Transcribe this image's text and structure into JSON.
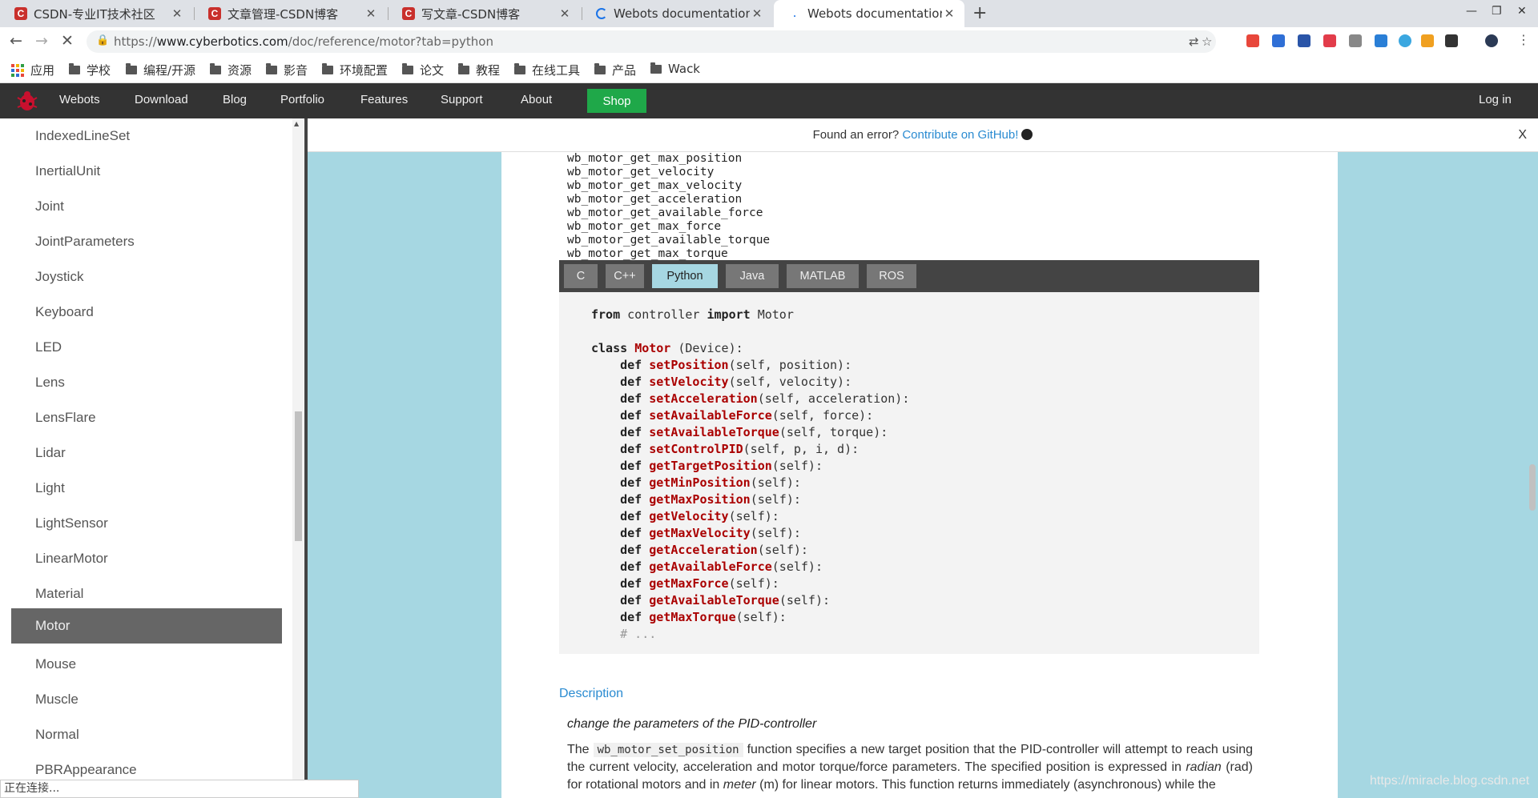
{
  "browser": {
    "tabs": [
      {
        "title": "CSDN-专业IT技术社区",
        "favicon": "csdn-icon"
      },
      {
        "title": "文章管理-CSDN博客",
        "favicon": "csdn-icon"
      },
      {
        "title": "写文章-CSDN博客",
        "favicon": "csdn-icon"
      },
      {
        "title": "Webots documentation: \\",
        "favicon": "loading-icon"
      },
      {
        "title": "Webots documentation: M",
        "favicon": "loading-icon",
        "active": true
      }
    ],
    "url_prefix": "https://",
    "url_host": "www.cyberbotics.com",
    "url_path": "/doc/reference/motor?tab=python",
    "bookmarks": [
      "应用",
      "学校",
      "编程/开源",
      "资源",
      "影音",
      "环境配置",
      "论文",
      "教程",
      "在线工具",
      "产品",
      "Wack"
    ],
    "status_text": "正在连接..."
  },
  "site": {
    "nav": [
      "Webots",
      "Download",
      "Blog",
      "Portfolio",
      "Features",
      "Support",
      "About"
    ],
    "shop_label": "Shop",
    "login_label": "Log in"
  },
  "sidebar": {
    "items": [
      "IndexedLineSet",
      "InertialUnit",
      "Joint",
      "JointParameters",
      "Joystick",
      "Keyboard",
      "LED",
      "Lens",
      "LensFlare",
      "Lidar",
      "Light",
      "LightSensor",
      "LinearMotor",
      "Material",
      "Motor",
      "Mouse",
      "Muscle",
      "Normal",
      "PBRAppearance"
    ],
    "active": "Motor"
  },
  "errbar": {
    "text": "Found an error? ",
    "link": "Contribute on GitHub!",
    "close": "X"
  },
  "article": {
    "functions": [
      "wb_motor_get_max_position",
      "wb_motor_get_velocity",
      "wb_motor_get_max_velocity",
      "wb_motor_get_acceleration",
      "wb_motor_get_available_force",
      "wb_motor_get_max_force",
      "wb_motor_get_available_torque",
      "wb_motor_get_max_torque"
    ],
    "lang_tabs": [
      "C",
      "C++",
      "Python",
      "Java",
      "MATLAB",
      "ROS"
    ],
    "active_lang": "Python",
    "code": {
      "import_from": "from",
      "import_module": " controller ",
      "import_kw": "import",
      "import_name": " Motor",
      "class_kw": "class",
      "class_name": "Motor",
      "class_base": " (Device):",
      "methods": [
        {
          "name": "setPosition",
          "args": "(self, position):"
        },
        {
          "name": "setVelocity",
          "args": "(self, velocity):"
        },
        {
          "name": "setAcceleration",
          "args": "(self, acceleration):"
        },
        {
          "name": "setAvailableForce",
          "args": "(self, force):"
        },
        {
          "name": "setAvailableTorque",
          "args": "(self, torque):"
        },
        {
          "name": "setControlPID",
          "args": "(self, p, i, d):"
        },
        {
          "name": "getTargetPosition",
          "args": "(self):"
        },
        {
          "name": "getMinPosition",
          "args": "(self):"
        },
        {
          "name": "getMaxPosition",
          "args": "(self):"
        },
        {
          "name": "getVelocity",
          "args": "(self):"
        },
        {
          "name": "getMaxVelocity",
          "args": "(self):"
        },
        {
          "name": "getAcceleration",
          "args": "(self):"
        },
        {
          "name": "getAvailableForce",
          "args": "(self):"
        },
        {
          "name": "getMaxForce",
          "args": "(self):"
        },
        {
          "name": "getAvailableTorque",
          "args": "(self):"
        },
        {
          "name": "getMaxTorque",
          "args": "(self):"
        }
      ],
      "def_kw": "def",
      "comment": "# ..."
    },
    "description_heading": "Description",
    "description_subtitle": "change the parameters of the PID-controller",
    "desc_the": "The ",
    "desc_code": "wb_motor_set_position",
    "desc_rest1": " function specifies a new target position that the PID-controller will attempt to reach using the current velocity, acceleration and motor torque/force parameters. The specified position is expressed in ",
    "desc_radian": "radian",
    "desc_rest2": " (rad) for rotational motors and in ",
    "desc_meter": "meter",
    "desc_rest3": " (m) for linear motors. This function returns immediately (asynchronous) while the"
  },
  "watermark": "https://miracle.blog.csdn.net",
  "colors": {
    "accent_link": "#2a8bd1",
    "shop_green": "#1fa849",
    "active_tab": "#a6d7e2",
    "code_fn": "#aa0000"
  }
}
